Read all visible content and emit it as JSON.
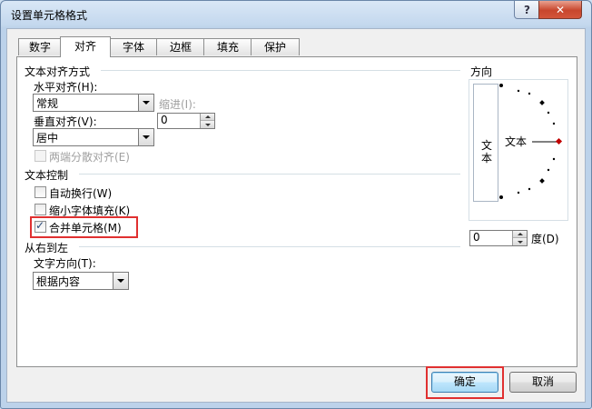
{
  "window": {
    "title": "设置单元格格式"
  },
  "tabs": [
    {
      "label": "数字"
    },
    {
      "label": "对齐"
    },
    {
      "label": "字体"
    },
    {
      "label": "边框"
    },
    {
      "label": "填充"
    },
    {
      "label": "保护"
    }
  ],
  "alignment": {
    "section_title": "文本对齐方式",
    "horizontal_label": "水平对齐(H):",
    "horizontal_value": "常规",
    "indent_label": "缩进(I):",
    "indent_value": "0",
    "vertical_label": "垂直对齐(V):",
    "vertical_value": "居中",
    "distributed_label": "两端分散对齐(E)"
  },
  "text_control": {
    "section_title": "文本控制",
    "wrap_label": "自动换行(W)",
    "wrap_checked": false,
    "shrink_label": "缩小字体填充(K)",
    "shrink_checked": false,
    "merge_label": "合并单元格(M)",
    "merge_checked": true
  },
  "rtl": {
    "section_title": "从右到左",
    "direction_label": "文字方向(T):",
    "direction_value": "根据内容"
  },
  "orientation": {
    "section_title": "方向",
    "vertical_text": "文本",
    "dial_text": "文本",
    "degree_value": "0",
    "degree_label": "度(D)"
  },
  "buttons": {
    "ok": "确定",
    "cancel": "取消"
  },
  "colors": {
    "highlight": "#e03030",
    "dial_marker": "#c00000"
  }
}
